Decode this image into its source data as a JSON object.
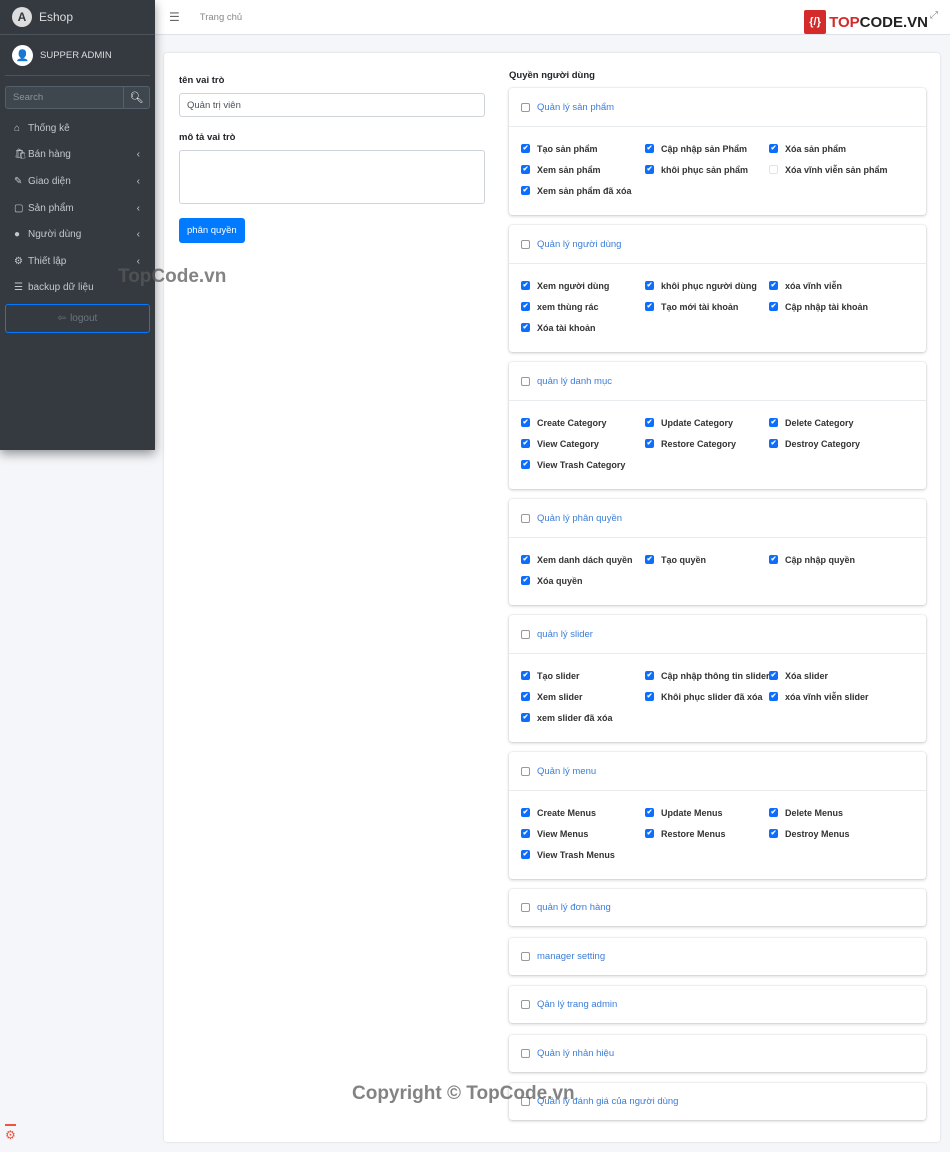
{
  "sidebar": {
    "brand": "Eshop",
    "user": "SUPPER ADMIN",
    "search_placeholder": "Search",
    "items": [
      {
        "label": "Thống kê",
        "icon": "home-icon",
        "sub": false
      },
      {
        "label": "Bán hàng",
        "icon": "bag-icon",
        "sub": true
      },
      {
        "label": "Giao diện",
        "icon": "brush-icon",
        "sub": true
      },
      {
        "label": "Sản phẩm",
        "icon": "box-icon",
        "sub": true
      },
      {
        "label": "Người dùng",
        "icon": "user-icon",
        "sub": true
      },
      {
        "label": "Thiết lập",
        "icon": "gear-icon",
        "sub": true
      },
      {
        "label": "backup dữ liệu",
        "icon": "database-icon",
        "sub": false
      }
    ],
    "logout": "logout"
  },
  "topbar": {
    "breadcrumb": "Trang chủ",
    "logo": "TOPCODE.VN"
  },
  "form": {
    "name_label": "tên vai trò",
    "name_value": "Quản trị  viên",
    "desc_label": "mô tả vai trò",
    "desc_value": "",
    "submit": "phân quyền"
  },
  "permissions": {
    "title": "Quyền người dùng",
    "groups": [
      {
        "name": "Quản lý sản phẩm",
        "checked": false,
        "perms": [
          {
            "l": "Tạo sản phẩm",
            "c": true
          },
          {
            "l": "Cập nhập sản Phẩm",
            "c": true
          },
          {
            "l": "Xóa sản phẩm",
            "c": true
          },
          {
            "l": "Xem sản phẩm",
            "c": true
          },
          {
            "l": "khôi phục sản phẩm",
            "c": true
          },
          {
            "l": "Xóa vĩnh viễn sản phẩm",
            "c": false
          },
          {
            "l": "Xem sản phẩm đã xóa",
            "c": true
          }
        ]
      },
      {
        "name": "Quản lý người dùng",
        "checked": false,
        "perms": [
          {
            "l": "Xem người dùng",
            "c": true
          },
          {
            "l": "khôi phục người dùng",
            "c": true
          },
          {
            "l": "xóa vĩnh viễn",
            "c": true
          },
          {
            "l": "xem thùng rác",
            "c": true
          },
          {
            "l": "Tạo mới tài khoản",
            "c": true
          },
          {
            "l": "Cập nhập tài khoản",
            "c": true
          },
          {
            "l": "Xóa tài khoản",
            "c": true
          }
        ]
      },
      {
        "name": "quản lý danh mục",
        "checked": false,
        "perms": [
          {
            "l": "Create Category",
            "c": true
          },
          {
            "l": "Update Category",
            "c": true
          },
          {
            "l": "Delete Category",
            "c": true
          },
          {
            "l": "View Category",
            "c": true
          },
          {
            "l": "Restore Category",
            "c": true
          },
          {
            "l": "Destroy Category",
            "c": true
          },
          {
            "l": "View Trash Category",
            "c": true
          }
        ]
      },
      {
        "name": "Quản lý phân quyền",
        "checked": false,
        "perms": [
          {
            "l": "Xem danh dách quyền",
            "c": true
          },
          {
            "l": "Tạo quyền",
            "c": true
          },
          {
            "l": "Cập nhập quyền",
            "c": true
          },
          {
            "l": "Xóa quyền",
            "c": true
          }
        ]
      },
      {
        "name": "quản lý slider",
        "checked": false,
        "perms": [
          {
            "l": "Tạo slider",
            "c": true
          },
          {
            "l": "Cập nhập thông tin slider",
            "c": true
          },
          {
            "l": "Xóa slider",
            "c": true
          },
          {
            "l": "Xem slider",
            "c": true
          },
          {
            "l": "Khôi phục slider đã xóa",
            "c": true
          },
          {
            "l": "xóa vĩnh viễn slider",
            "c": true
          },
          {
            "l": "xem slider đã xóa",
            "c": true
          }
        ]
      },
      {
        "name": "Quản lý menu",
        "checked": false,
        "perms": [
          {
            "l": "Create Menus",
            "c": true
          },
          {
            "l": "Update Menus",
            "c": true
          },
          {
            "l": "Delete Menus",
            "c": true
          },
          {
            "l": "View Menus",
            "c": true
          },
          {
            "l": "Restore Menus",
            "c": true
          },
          {
            "l": "Destroy Menus",
            "c": true
          },
          {
            "l": "View Trash Menus",
            "c": true
          }
        ]
      },
      {
        "name": "quản lý đơn hàng",
        "checked": false,
        "perms": []
      },
      {
        "name": "manager setting",
        "checked": false,
        "perms": []
      },
      {
        "name": "Qản lý trang admin",
        "checked": false,
        "perms": []
      },
      {
        "name": "Quản lý nhản hiệu",
        "checked": false,
        "perms": []
      },
      {
        "name": "Quản lý đánh giá của người dùng",
        "checked": false,
        "perms": []
      }
    ]
  },
  "watermarks": [
    "TopCode.vn",
    "Copyright © TopCode.vn"
  ]
}
